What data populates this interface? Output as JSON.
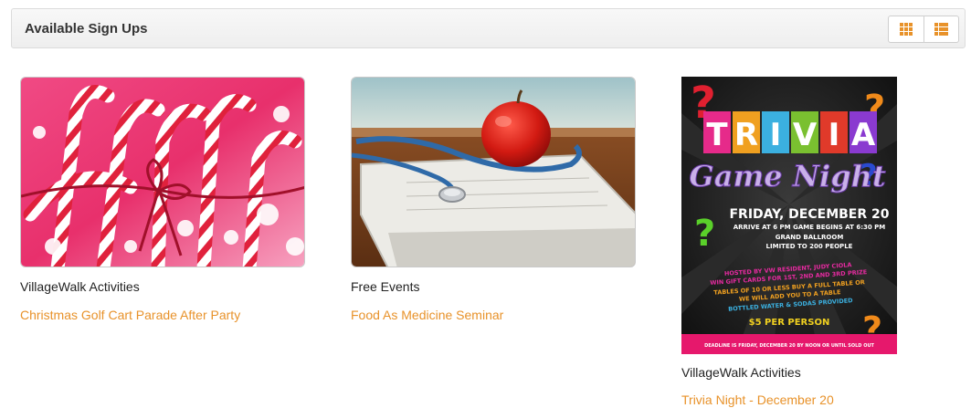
{
  "header": {
    "title": "Available Sign Ups",
    "view_toggle": {
      "grid_icon": "grid-view-icon",
      "list_icon": "list-view-icon",
      "accent_color": "#e8922a"
    }
  },
  "cards": [
    {
      "category": "VillageWalk Activities",
      "title": "Christmas Golf Cart Parade After Party",
      "image": "candy-canes-with-red-ribbon"
    },
    {
      "category": "Free Events",
      "title": "Food As Medicine Seminar",
      "image": "red-apple-with-stethoscope-on-clipboard"
    },
    {
      "category": "VillageWalk Activities",
      "title": "Trivia Night - December 20",
      "image": "trivia-game-night-poster",
      "poster": {
        "title_letters": [
          "T",
          "R",
          "I",
          "V",
          "I",
          "A"
        ],
        "subtitle": "Game Night",
        "date": "FRIDAY, DECEMBER 20",
        "lines": [
          "ARRIVE AT 6 PM GAME BEGINS AT 6:30 PM",
          "GRAND BALLROOM",
          "LIMITED TO 200 PEOPLE"
        ],
        "host_lines": [
          "HOSTED BY VW RESIDENT, JUDY CIOLA",
          "WIN GIFT CARDS FOR 1ST, 2ND AND 3RD PRIZE",
          "TABLES OF 10 OR LESS BUY A FULL TABLE OR",
          "WE WILL ADD YOU TO A TABLE",
          "BOTTLED WATER & SODAS PROVIDED"
        ],
        "price": "$5 PER PERSON",
        "deadline": "DEADLINE IS FRIDAY, DECEMBER 20 BY NOON OR UNTIL SOLD OUT"
      }
    }
  ]
}
